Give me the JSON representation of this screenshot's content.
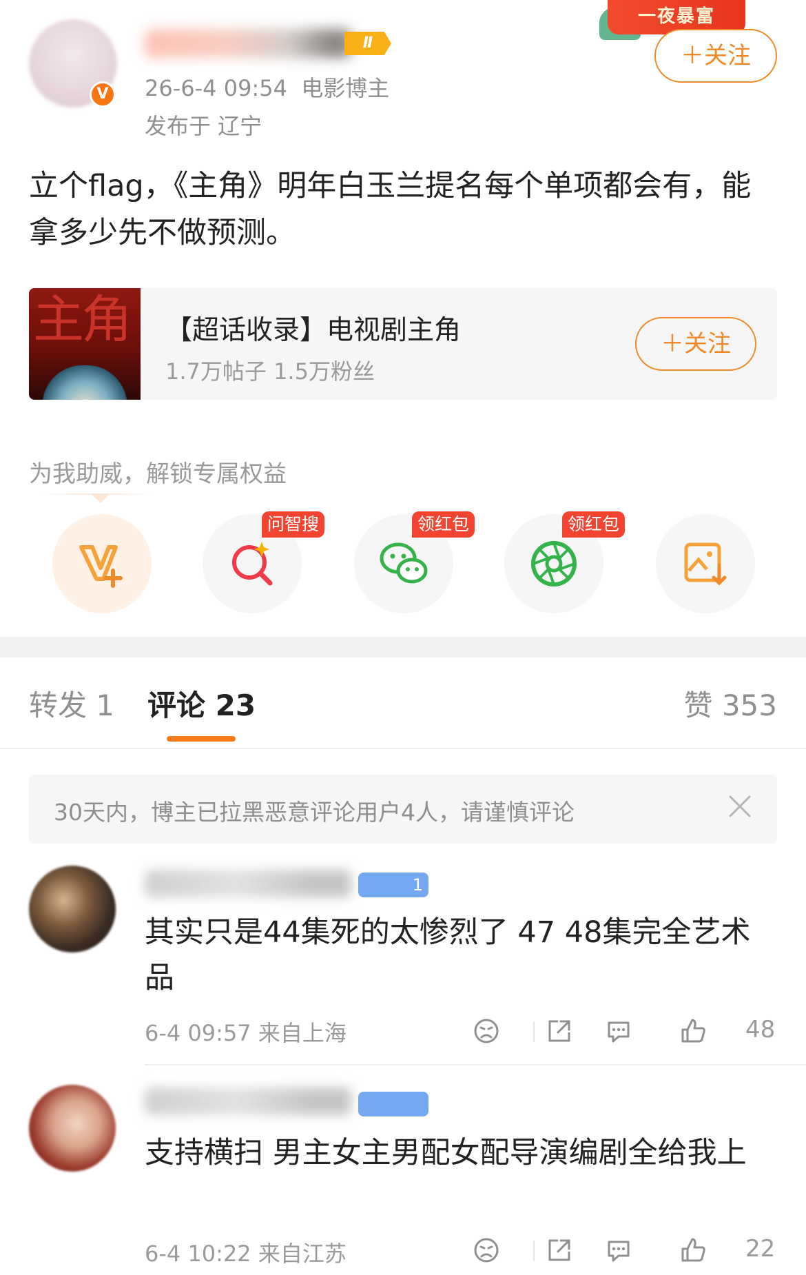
{
  "post": {
    "author": {
      "avatar_icon": "avatar-placeholder",
      "verified_icon": "v-badge",
      "level_badge": "Ⅱ"
    },
    "time": "26-6-4 09:54",
    "author_tag": "电影博主",
    "location": "发布于 辽宁",
    "follow_label": "＋关注",
    "banner_text": "一夜暴富",
    "content": "立个flag，《主角》明年白玉兰提名每个单项都会有，能拿多少先不做预测。"
  },
  "topic_card": {
    "image_text": "主角",
    "title": "【超话收录】电视剧主角",
    "stats": "1.7万帖子 1.5万粉丝",
    "follow_label": "＋关注"
  },
  "boost": {
    "label": "为我助威，解锁专属权益",
    "items": [
      {
        "icon": "v-plus-icon",
        "tag": ""
      },
      {
        "icon": "ai-search-icon",
        "tag": "问智搜"
      },
      {
        "icon": "wechat-icon",
        "tag": "领红包"
      },
      {
        "icon": "moments-icon",
        "tag": "领红包"
      },
      {
        "icon": "save-image-icon",
        "tag": ""
      }
    ]
  },
  "tabs": {
    "repost": "转发 1",
    "comments": "评论 23",
    "likes": "赞 353"
  },
  "notice": {
    "text": "30天内，博主已拉黑恶意评论用户4人，请谨慎评论",
    "close_icon": "close-icon"
  },
  "comments": [
    {
      "badge": "1",
      "text": "其实只是44集死的太惨烈了 47 48集完全艺术品",
      "meta": "6-4 09:57 来自上海",
      "likes": "48"
    },
    {
      "badge": "",
      "text": "支持横扫 男主女主男配女配导演编剧全给我上",
      "meta": "6-4 10:22 来自江苏",
      "likes": "22"
    }
  ],
  "colors": {
    "accent_orange": "#f08a29",
    "tab_underline": "#f67c1b",
    "red_tag": "#f24431",
    "verified": "#f97511",
    "fan_badge": "#74a9f2"
  }
}
